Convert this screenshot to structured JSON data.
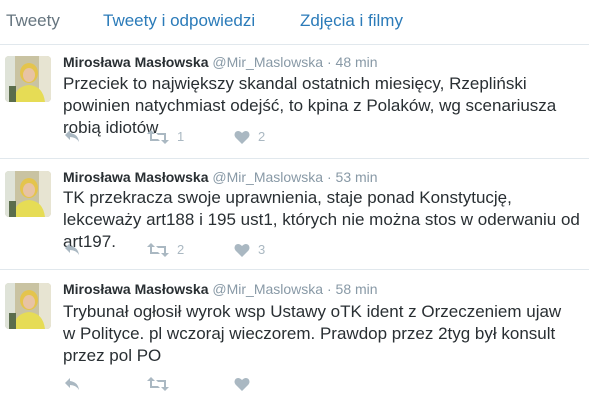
{
  "tabs": [
    {
      "label": "Tweety",
      "active": true
    },
    {
      "label": "Tweety i odpowiedzi",
      "active": false
    },
    {
      "label": "Zdjęcia i filmy",
      "active": false
    }
  ],
  "tweets": [
    {
      "name": "Mirosława Masłowska",
      "handle": "@Mir_Maslowska",
      "dot": "·",
      "time": "48 min",
      "text": "Przeciek to największy skandal ostatnich miesięcy, Rzepliński powinien natychmiast odejść, to kpina z Polaków, wg scenariusza robią idiotów",
      "retweets": "1",
      "likes": "2"
    },
    {
      "name": "Mirosława Masłowska",
      "handle": "@Mir_Maslowska",
      "dot": "·",
      "time": "53 min",
      "text": "TK przekracza swoje uprawnienia, staje ponad Konstytucję, lekceważy art188 i 195 ust1, których nie można stos w oderwaniu od art197.",
      "retweets": "2",
      "likes": "3"
    },
    {
      "name": "Mirosława Masłowska",
      "handle": "@Mir_Maslowska",
      "dot": "·",
      "time": "58 min",
      "text": "Trybunał ogłosił wyrok wsp Ustawy oTK ident z Orzeczeniem ujaw w Polityce. pl wczoraj wieczorem. Prawdop przez 2tyg był konsult przez pol PO",
      "retweets": "",
      "likes": ""
    }
  ],
  "icons": {
    "reply": "reply-icon",
    "retweet": "retweet-icon",
    "like": "heart-icon"
  },
  "colors": {
    "link": "#2b7bb9",
    "muted": "#8899a6",
    "action": "#aab8c2",
    "text": "#292f33"
  }
}
